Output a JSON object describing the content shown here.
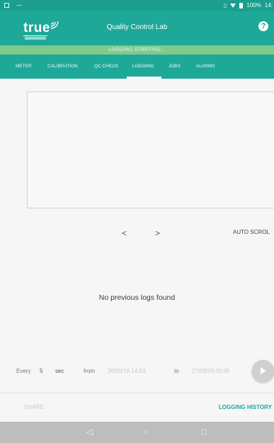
{
  "status": {
    "battery": "100%",
    "time": "14:"
  },
  "app": {
    "logo_text": "true",
    "title": "Quality Control Lab"
  },
  "banner": "LOGGING STARTING...",
  "tabs": [
    "METER",
    "CALIBRATION",
    "QC CHECK",
    "LOGGING",
    "JOBS",
    "ALARMS"
  ],
  "active_tab": "LOGGING",
  "graph": {
    "prev": "<",
    "next": ">",
    "autoscroll": "AUTO SCROL"
  },
  "message": "No previous logs found",
  "log": {
    "every_label": "Every",
    "every_value": "5",
    "unit": "sec",
    "from_label": "from",
    "from_value": "26/09/16 14:53",
    "to_label": "to",
    "to_value": "27/09/16 09:05"
  },
  "actions": {
    "share": "SHARE",
    "history": "LOGGING HISTORY"
  },
  "colors": {
    "primary": "#1ea898",
    "banner": "#7fc98f",
    "navbar": "#bdbdbd"
  }
}
